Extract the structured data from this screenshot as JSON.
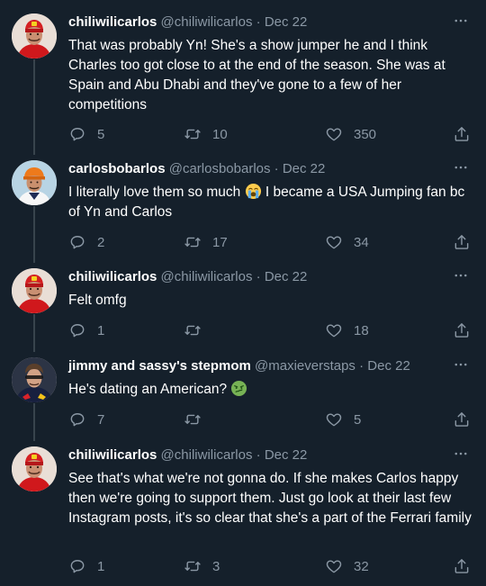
{
  "tweets": [
    {
      "name": "chiliwilicarlos",
      "handle": "@chiliwilicarlos",
      "date": "Dec 22",
      "text": "That was probably Yn! She's a show jumper he and I think Charles too got close to at the end of the season. She was at Spain and Abu Dhabi and they've gone to a few of her competitions",
      "replies": "5",
      "retweets": "10",
      "likes": "350",
      "avatar": "ferrari-driver-avatar"
    },
    {
      "name": "carlosbobarlos",
      "handle": "@carlosbobarlos",
      "date": "Dec 22",
      "text_before": "I literally love them so much ",
      "emoji": "loudly-crying-face-emoji",
      "text_after": " I became a USA Jumping fan bc of Yn and Carlos",
      "replies": "2",
      "retweets": "17",
      "likes": "34",
      "avatar": "mclaren-driver-avatar"
    },
    {
      "name": "chiliwilicarlos",
      "handle": "@chiliwilicarlos",
      "date": "Dec 22",
      "text": "Felt omfg",
      "replies": "1",
      "retweets": "",
      "likes": "18",
      "avatar": "ferrari-driver-avatar"
    },
    {
      "name": "jimmy and sassy's stepmom",
      "handle": "@maxieverstaps",
      "date": "Dec 22",
      "text_before": "He's dating an American? ",
      "emoji": "nauseated-face-emoji",
      "text_after": "",
      "replies": "7",
      "retweets": "",
      "likes": "5",
      "avatar": "redbull-driver-avatar"
    },
    {
      "name": "chiliwilicarlos",
      "handle": "@chiliwilicarlos",
      "date": "Dec 22",
      "text": "See that's what we're not gonna do. If she makes Carlos happy then we're going to support them. Just go look at their last few Instagram posts, it's so clear that she's a part of the Ferrari family",
      "replies": "1",
      "retweets": "3",
      "likes": "32",
      "avatar": "ferrari-driver-avatar"
    }
  ],
  "separator": " · ",
  "colors": {
    "background": "#15202b",
    "secondary_text": "#8b98a5",
    "thread_line": "#38444d"
  }
}
